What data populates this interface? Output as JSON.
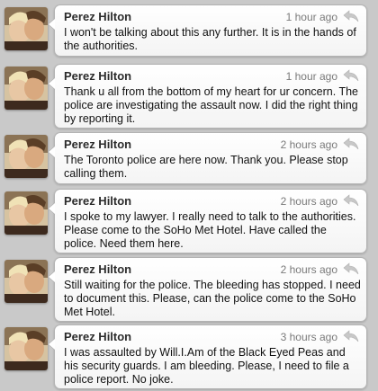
{
  "tweets": [
    {
      "author": "Perez Hilton",
      "time": "1 hour ago",
      "text": "I won't be talking about this any further. It is in the hands of the authorities."
    },
    {
      "author": "Perez Hilton",
      "time": "1 hour ago",
      "text": "Thank u all from the bottom of my heart for ur concern. The police are investigating the assault now. I did the right thing by reporting it."
    },
    {
      "author": "Perez Hilton",
      "time": "2 hours ago",
      "text": "The Toronto police are here now. Thank you. Please stop calling them."
    },
    {
      "author": "Perez Hilton",
      "time": "2 hours ago",
      "text": "I spoke to my lawyer. I really need to talk to the authorities. Please come to the SoHo Met Hotel. Have called the police. Need them here."
    },
    {
      "author": "Perez Hilton",
      "time": "2 hours ago",
      "text": "Still waiting for the police. The bleeding has stopped. I need to document this. Please, can the police come to the SoHo Met Hotel."
    },
    {
      "author": "Perez Hilton",
      "time": "3 hours ago",
      "text": "I was assaulted by Will.I.Am of the Black Eyed Peas and his security guards. I am bleeding. Please, I need to file a police report. No joke."
    }
  ]
}
